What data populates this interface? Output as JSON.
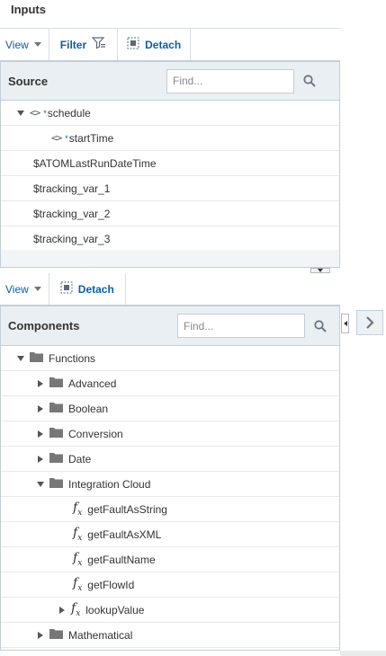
{
  "header": {
    "title": "Inputs"
  },
  "source_toolbar": {
    "view_label": "View",
    "filter_label": "Filter",
    "detach_label": "Detach"
  },
  "source": {
    "title": "Source",
    "find_placeholder": "Find...",
    "rows": [
      {
        "label": "schedule",
        "required": "*"
      },
      {
        "label": "startTime",
        "required": "*"
      },
      {
        "label": "$ATOMLastRunDateTime"
      },
      {
        "label": "$tracking_var_1"
      },
      {
        "label": "$tracking_var_2"
      },
      {
        "label": "$tracking_var_3"
      }
    ]
  },
  "components_toolbar": {
    "view_label": "View",
    "detach_label": "Detach"
  },
  "components": {
    "title": "Components",
    "find_placeholder": "Find...",
    "rows": [
      {
        "label": "Functions"
      },
      {
        "label": "Advanced"
      },
      {
        "label": "Boolean"
      },
      {
        "label": "Conversion"
      },
      {
        "label": "Date"
      },
      {
        "label": "Integration Cloud"
      },
      {
        "label": "getFaultAsString"
      },
      {
        "label": "getFaultAsXML"
      },
      {
        "label": "getFaultName"
      },
      {
        "label": "getFlowId"
      },
      {
        "label": "lookupValue"
      },
      {
        "label": "Mathematical"
      }
    ]
  },
  "icons": {
    "code": "<>",
    "fx": "f",
    "fx_sub": "x"
  },
  "colors": {
    "link": "#0b5faa",
    "panel_header": "#eaeff3",
    "border": "#c4ced7"
  }
}
